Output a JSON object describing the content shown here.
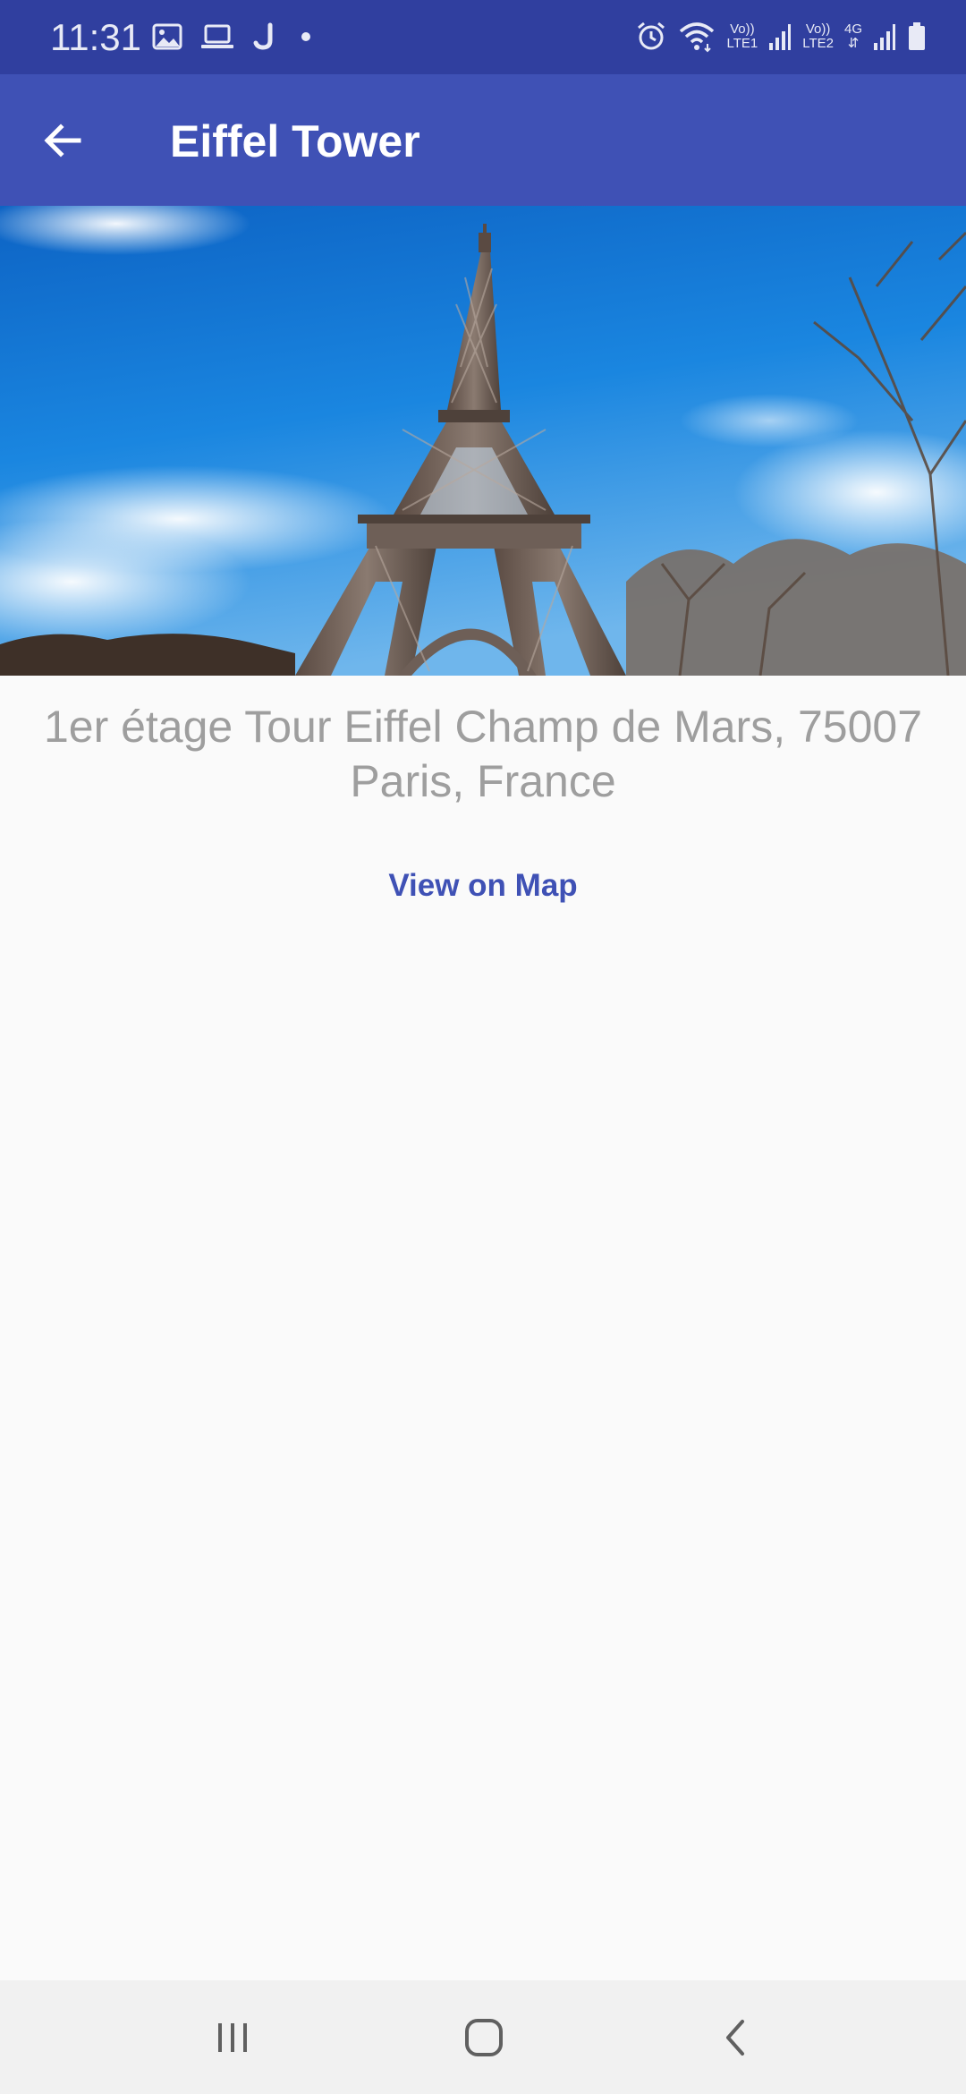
{
  "status_bar": {
    "time": "11:31",
    "left_icons": [
      "gallery-icon",
      "laptop-icon",
      "j-app-icon",
      "dot-icon"
    ],
    "right_icons": [
      "alarm-icon",
      "wifi-icon",
      "signal-lte1-icon",
      "signal-lte2-icon",
      "battery-icon"
    ],
    "lte1_top": "Vo))",
    "lte1_bottom": "LTE1",
    "lte2_top": "Vo))",
    "lte2_bottom": "LTE2",
    "network_type": "4G"
  },
  "app_bar": {
    "title": "Eiffel Tower",
    "back_icon": "arrow-left-icon",
    "color": "#3f51b5"
  },
  "hero_image": {
    "subject": "eiffel-tower-photo"
  },
  "content": {
    "address": "1er étage Tour Eiffel Champ de Mars, 75007 Paris, France",
    "view_on_map": "View on Map"
  },
  "nav_bar": {
    "buttons": [
      "recents-icon",
      "home-icon",
      "back-icon"
    ]
  },
  "colors": {
    "status_bar": "#303f9f",
    "primary": "#3f51b5",
    "background": "#fafafa",
    "address_text": "#9e9e9e",
    "nav_bar": "#f1f1f1"
  }
}
